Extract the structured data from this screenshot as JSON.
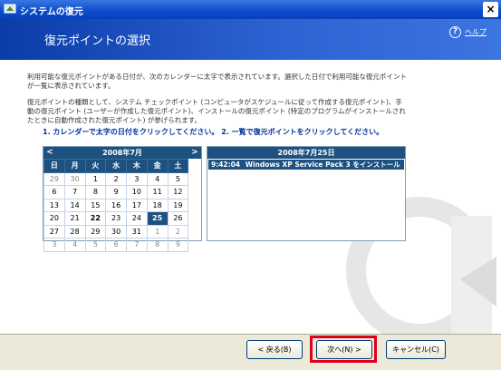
{
  "window": {
    "title": "システムの復元",
    "close_label": "×"
  },
  "header": {
    "title": "復元ポイントの選択",
    "help_label": "ヘルプ",
    "help_icon": "?"
  },
  "intro": {
    "paragraph1": "利用可能な復元ポイントがある日付が、次のカレンダーに太字で表示されています。選択した日付で利用可能な復元ポイントが一覧に表示されています。",
    "paragraph2": "復元ポイントの種類として、システム チェックポイント (コンピュータがスケジュールに従って作成する復元ポイント)、手動の復元ポイント (ユーザーが作成した復元ポイント)、インストールの復元ポイント (特定のプログラムがインストールされたときに自動作成された復元ポイント) が挙げられます。"
  },
  "steps": {
    "label": "1. カレンダーで太字の日付をクリックしてください。 2. 一覧で復元ポイントをクリックしてください。"
  },
  "calendar": {
    "month_title": "2008年7月",
    "prev": "<",
    "next": ">",
    "weekdays": [
      "日",
      "月",
      "火",
      "水",
      "木",
      "金",
      "土"
    ],
    "weeks": [
      [
        "29",
        "30",
        "1",
        "2",
        "3",
        "4",
        "5"
      ],
      [
        "6",
        "7",
        "8",
        "9",
        "10",
        "11",
        "12"
      ],
      [
        "13",
        "14",
        "15",
        "16",
        "17",
        "18",
        "19"
      ],
      [
        "20",
        "21",
        "22",
        "23",
        "24",
        "25",
        "26"
      ],
      [
        "27",
        "28",
        "29",
        "30",
        "31",
        "1",
        "2"
      ],
      [
        "3",
        "4",
        "5",
        "6",
        "7",
        "8",
        "9"
      ]
    ],
    "bold_dates": [
      "22",
      "25"
    ],
    "selected_date": "25"
  },
  "restore_list": {
    "header": "2008年7月25日",
    "items": [
      {
        "time": "9:42:04",
        "description": "Windows XP Service Pack 3 をインストール"
      }
    ]
  },
  "buttons": {
    "back": "< 戻る(B)",
    "next": "次へ(N) >",
    "cancel": "キャンセル(C)"
  },
  "colors": {
    "calendar_header": "#1c5180",
    "focus_highlight": "#e0001a",
    "header_gradient_start": "#0b3ca8"
  }
}
